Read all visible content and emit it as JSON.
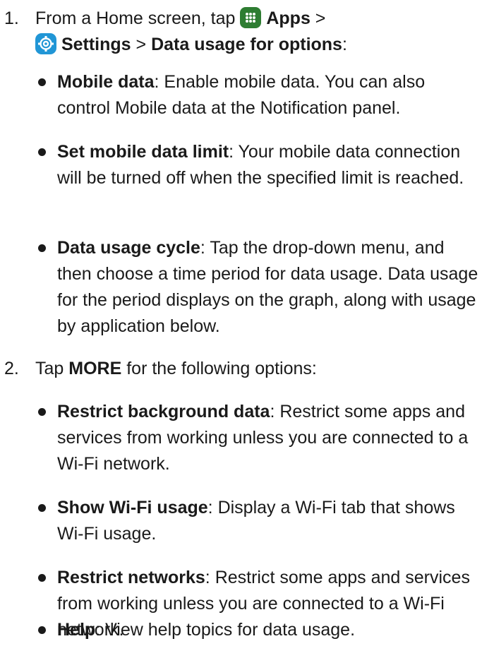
{
  "steps": [
    {
      "number": "1.",
      "intro": {
        "pre": "From a Home screen, tap",
        "apps_label": "Apps",
        "sep1": ">",
        "settings_label": "Settings",
        "sep2": ">",
        "data_usage_label": "Data usage for options",
        "end": ":"
      },
      "icons": [
        "apps-grid-icon",
        "settings-gear-icon"
      ],
      "bullets": [
        {
          "term": "Mobile data",
          "text": ": Enable mobile data. You can also control Mobile data at the Notification panel."
        },
        {
          "term": "Set mobile data limit",
          "text": ": Your mobile data connection will be turned off when the specified limit is reached."
        },
        {
          "term": "Data usage cycle",
          "text": ": Tap the drop-down menu, and then choose a time period for data usage. Data usage for the period displays on the graph, along with usage by application below."
        }
      ]
    },
    {
      "number": "2.",
      "intro": {
        "pre": "Tap",
        "more_label": "MORE",
        "post": "for the following options:"
      },
      "bullets": [
        {
          "term": "Restrict background data",
          "text": ": Restrict some apps and services from working unless you are connected to a Wi-Fi network."
        },
        {
          "term": "Show Wi-Fi usage",
          "text": ": Display a Wi-Fi tab that shows Wi-Fi usage."
        },
        {
          "term": "Restrict networks",
          "text": ": Restrict some apps and services from working unless you are connected to a Wi-Fi network."
        },
        {
          "term": "Help",
          "text": ": View help topics for data usage."
        }
      ]
    }
  ],
  "colors": {
    "text": "#1a1a1a",
    "apps_icon_bg": "#2e7d32",
    "settings_icon_bg": "#2196d6"
  }
}
